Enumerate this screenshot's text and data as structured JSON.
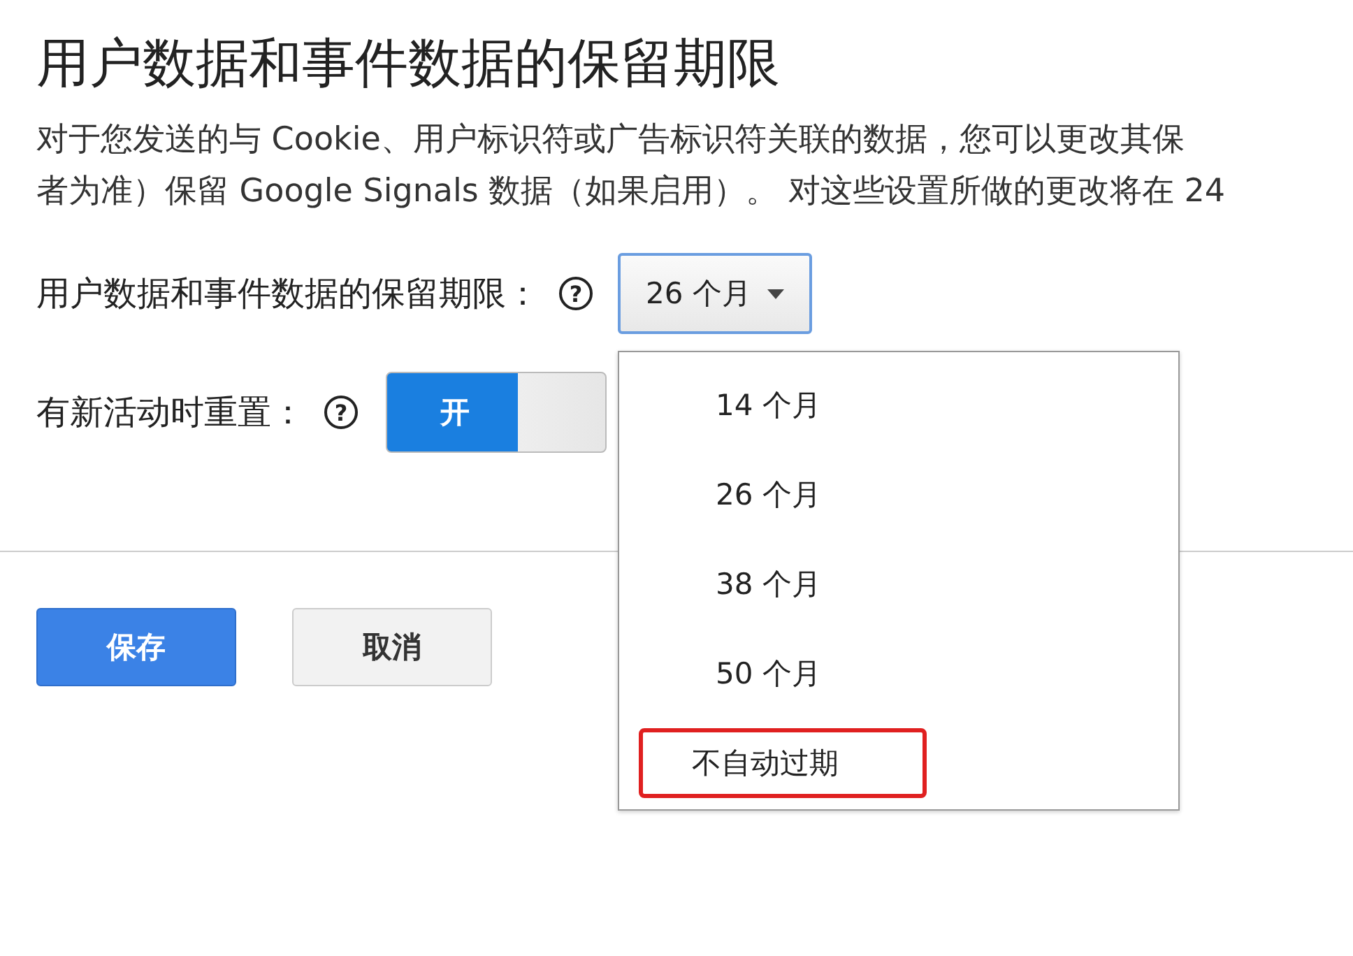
{
  "title": "用户数据和事件数据的保留期限",
  "description": [
    "对于您发送的与 Cookie、用户标识符或广告标识符关联的数据，您可以更改其保",
    "者为准）保留 Google Signals 数据（如果启用）。 对这些设置所做的更改将在 24"
  ],
  "retention": {
    "label": "用户数据和事件数据的保留期限：",
    "help": "?",
    "value": "26 个月",
    "expanded": true,
    "options": [
      {
        "label": "14 个月",
        "highlighted": false
      },
      {
        "label": "26 个月",
        "highlighted": false
      },
      {
        "label": "38 个月",
        "highlighted": false
      },
      {
        "label": "50 个月",
        "highlighted": false
      },
      {
        "label": "不自动过期",
        "highlighted": true
      }
    ]
  },
  "reset": {
    "label": "有新活动时重置：",
    "help": "?",
    "toggle_label": "开",
    "on": true
  },
  "buttons": [
    {
      "label": "保存",
      "kind": "primary"
    },
    {
      "label": "取消",
      "kind": "secondary"
    }
  ]
}
